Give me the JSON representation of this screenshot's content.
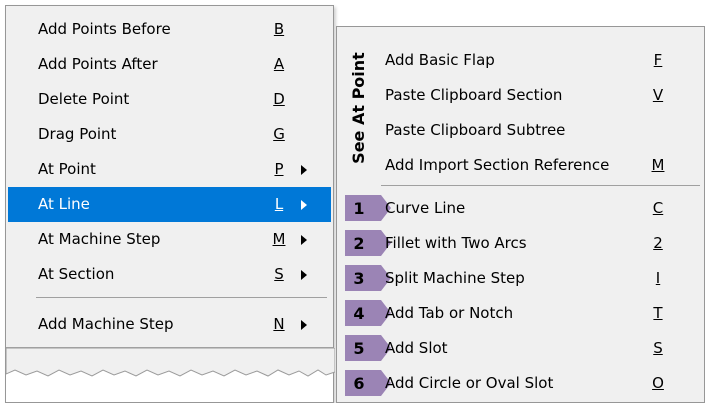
{
  "main_menu": {
    "items": [
      {
        "label": "Add Points Before",
        "key": "B",
        "submenu": false,
        "selected": false
      },
      {
        "label": "Add Points After",
        "key": "A",
        "submenu": false,
        "selected": false
      },
      {
        "label": "Delete Point",
        "key": "D",
        "submenu": false,
        "selected": false
      },
      {
        "label": "Drag Point",
        "key": "G",
        "submenu": false,
        "selected": false
      },
      {
        "label": "At Point",
        "key": "P",
        "submenu": true,
        "selected": false
      },
      {
        "label": "At Line",
        "key": "L",
        "submenu": true,
        "selected": true
      },
      {
        "label": "At Machine Step",
        "key": "M",
        "submenu": true,
        "selected": false
      },
      {
        "label": "At Section",
        "key": "S",
        "submenu": true,
        "selected": false
      },
      {
        "label": "Add Machine Step",
        "key": "N",
        "submenu": true,
        "selected": false
      }
    ]
  },
  "sub_menu": {
    "vertical_label": "See At Point",
    "top_items": [
      {
        "label": "Add Basic Flap",
        "key": "F"
      },
      {
        "label": "Paste Clipboard Section",
        "key": "V"
      },
      {
        "label": "Paste Clipboard Subtree",
        "key": ""
      },
      {
        "label": "Add Import Section Reference",
        "key": "M"
      }
    ],
    "numbered_items": [
      {
        "number": "1",
        "label": "Curve Line",
        "key": "C"
      },
      {
        "number": "2",
        "label": "Fillet with Two Arcs",
        "key": "2"
      },
      {
        "number": "3",
        "label": "Split Machine Step",
        "key": "I"
      },
      {
        "number": "4",
        "label": "Add Tab or Notch",
        "key": "T"
      },
      {
        "number": "5",
        "label": "Add Slot",
        "key": "S"
      },
      {
        "number": "6",
        "label": "Add Circle or Oval Slot",
        "key": "O"
      }
    ]
  },
  "colors": {
    "menu_bg": "#f0f0f0",
    "selected_bg": "#0078d7",
    "badge_arrow": "#9b84b5"
  }
}
